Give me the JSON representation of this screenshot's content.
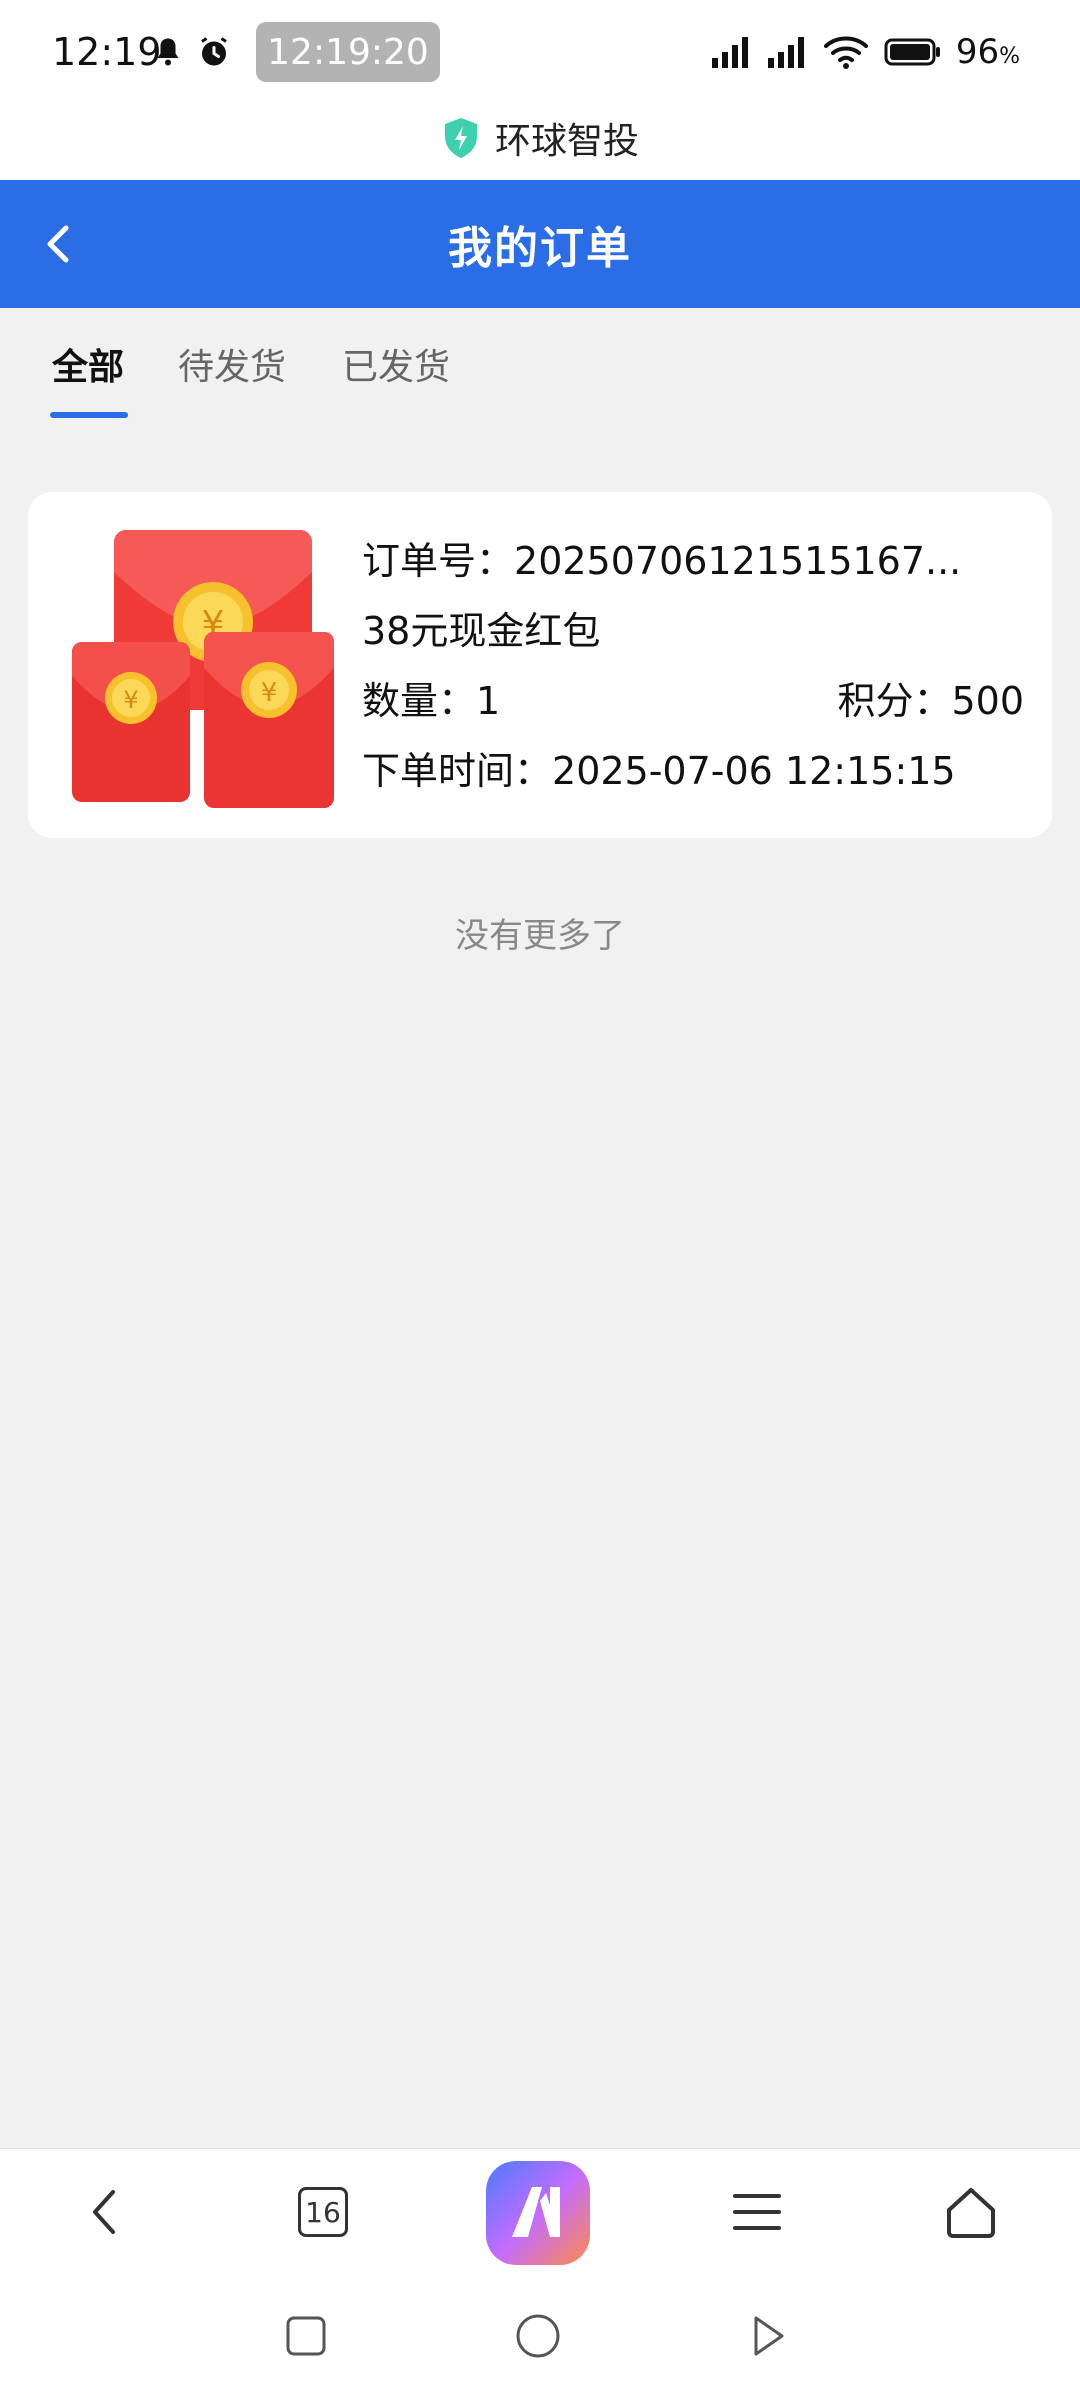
{
  "status_bar": {
    "time": "12:19",
    "pill_time": "12:19:20",
    "battery_percent": "96",
    "battery_unit": "%"
  },
  "app": {
    "name": "环球智投"
  },
  "header": {
    "title": "我的订单"
  },
  "tabs": [
    {
      "label": "全部",
      "active": true
    },
    {
      "label": "待发货",
      "active": false
    },
    {
      "label": "已发货",
      "active": false
    }
  ],
  "order": {
    "order_no_label": "订单号：",
    "order_no": "20250706121515167...",
    "product": "38元现金红包",
    "qty_label": "数量：",
    "qty": "1",
    "points_label": "积分：",
    "points": "500",
    "time_label": "下单时间：",
    "time": "2025-07-06 12:15:15"
  },
  "list_end_text": "没有更多了",
  "toolbar": {
    "tab_count": "16"
  },
  "colors": {
    "accent": "#2b6de6",
    "background": "#f1f1f1"
  }
}
